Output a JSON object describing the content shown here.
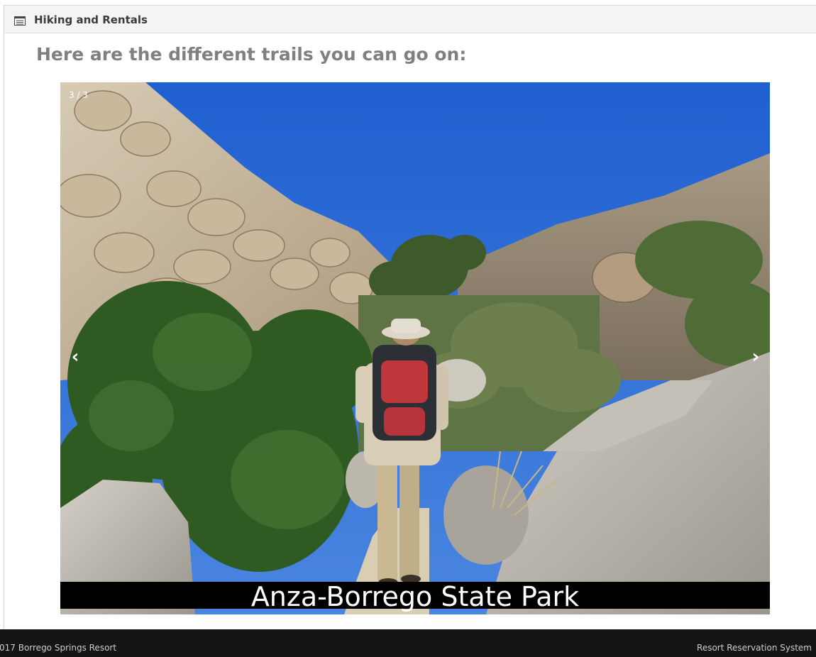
{
  "panel": {
    "title": "Hiking and Rentals",
    "icon": "list-icon"
  },
  "intro_text": "Here are the different trails you can go on:",
  "carousel": {
    "counter": "3 / 3",
    "prev_label": "‹",
    "next_label": "›",
    "caption": "Anza-Borrego State Park"
  },
  "footer": {
    "left_text": "017 Borrego Springs Resort",
    "right_text": "Resort Reservation System"
  },
  "colors": {
    "header_bg": "#f5f4f2",
    "footer_bg": "#141414",
    "intro_text": "#808080",
    "caption_bg": "#000000"
  }
}
